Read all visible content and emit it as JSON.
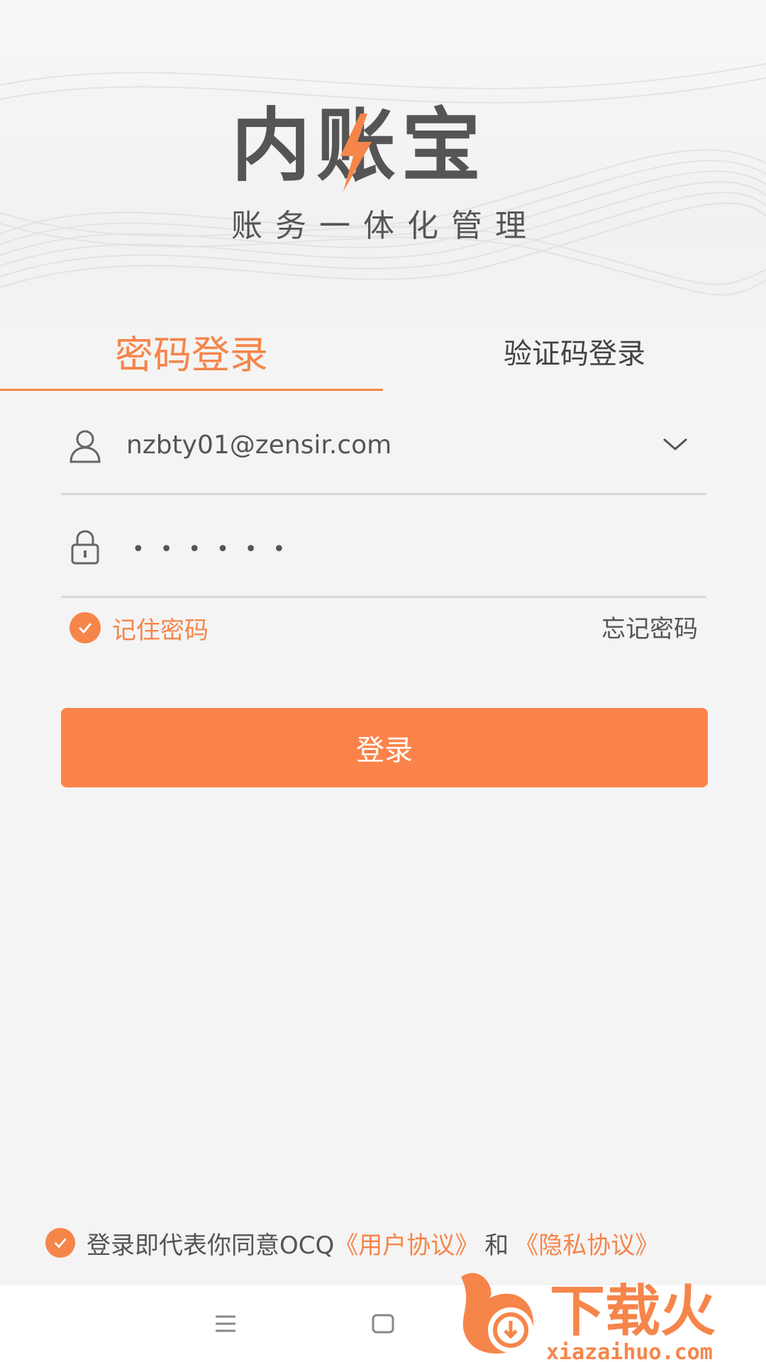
{
  "brand": {
    "logo_text": "内账宝",
    "tagline": "账务一体化管理"
  },
  "tabs": [
    {
      "label": "密码登录",
      "active": true
    },
    {
      "label": "验证码登录",
      "active": false
    }
  ],
  "form": {
    "username": "nzbty01@zensir.com",
    "password_mask": "••••••",
    "remember_label": "记住密码",
    "remember_checked": true,
    "forgot_label": "忘记密码",
    "login_label": "登录"
  },
  "agreement": {
    "checked": true,
    "prefix": "登录即代表你同意OCQ",
    "user_agreement": "《用户协议》",
    "and": "和",
    "privacy_policy": "《隐私协议》"
  },
  "watermark": {
    "text": "下载火",
    "url_text": "xiazaihuo.com"
  },
  "colors": {
    "accent": "#f6854a",
    "button": "#fb834a",
    "text": "#555555",
    "background": "#f4f4f4"
  },
  "icons": {
    "user": "user-icon",
    "lock": "lock-icon",
    "dropdown": "chevron-down-icon",
    "check": "check-icon",
    "nav_menu": "menu-icon",
    "nav_home": "home-square-icon"
  }
}
